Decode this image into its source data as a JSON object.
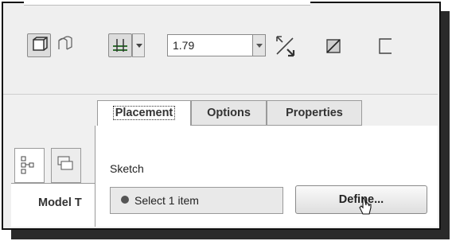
{
  "toolbar": {
    "extrude_type_solid": "solid-extrude-icon",
    "extrude_type_surface": "surface-extrude-icon",
    "depth_option_icon": "blind-depth-icon",
    "depth_value": "1.79",
    "flip_direction_icon": "flip-direction-icon",
    "remove_material_icon": "remove-material-icon",
    "thicken_icon": "thicken-sketch-icon"
  },
  "tabs": [
    {
      "label": "Placement",
      "active": true
    },
    {
      "label": "Options",
      "active": false
    },
    {
      "label": "Properties",
      "active": false
    }
  ],
  "placement_panel": {
    "section_label": "Sketch",
    "collector_text": "Select 1 item",
    "define_button": "Define..."
  },
  "model_tree": {
    "label": "Model T",
    "tab_icons": [
      "model-tree-icon",
      "layers-icon"
    ]
  }
}
